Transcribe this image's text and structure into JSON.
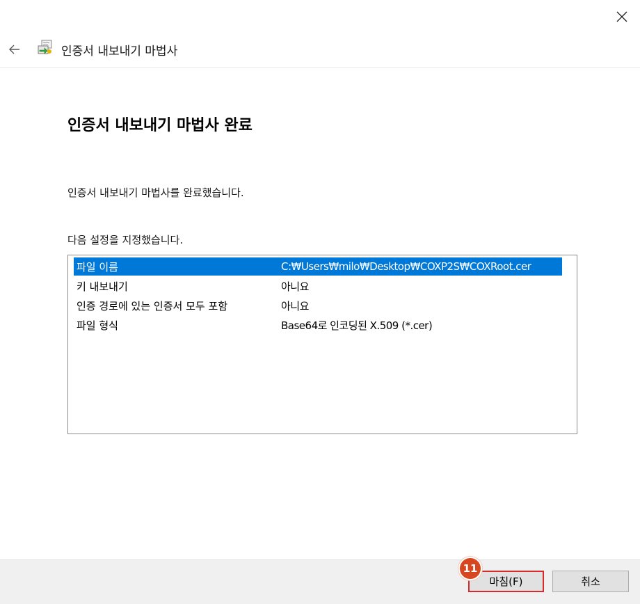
{
  "window": {
    "close_icon": "close-icon",
    "title": "인증서 내보내기 마법사",
    "back_icon": "back-arrow-icon",
    "wizard_icon": "certificate-export-icon"
  },
  "page": {
    "title": "인증서 내보내기 마법사 완료",
    "intro": "인증서 내보내기 마법사를 완료했습니다.",
    "settings_label": "다음 설정을 지정했습니다."
  },
  "settings": [
    {
      "name": "파일 이름",
      "value": "C:₩Users₩milo₩Desktop₩COXP2S₩COXRoot.cer",
      "selected": true
    },
    {
      "name": "키 내보내기",
      "value": "아니요",
      "selected": false
    },
    {
      "name": "인증 경로에 있는 인증서 모두 포함",
      "value": "아니요",
      "selected": false
    },
    {
      "name": "파일 형식",
      "value": "Base64로 인코딩된 X.509 (*.cer)",
      "selected": false
    }
  ],
  "footer": {
    "finish_label": "마침(F)",
    "cancel_label": "취소"
  },
  "annotation": {
    "step_badge": "11",
    "badge_color": "#d7471f",
    "highlight_color": "#d62b2b"
  },
  "colors": {
    "selection": "#0078d7"
  }
}
